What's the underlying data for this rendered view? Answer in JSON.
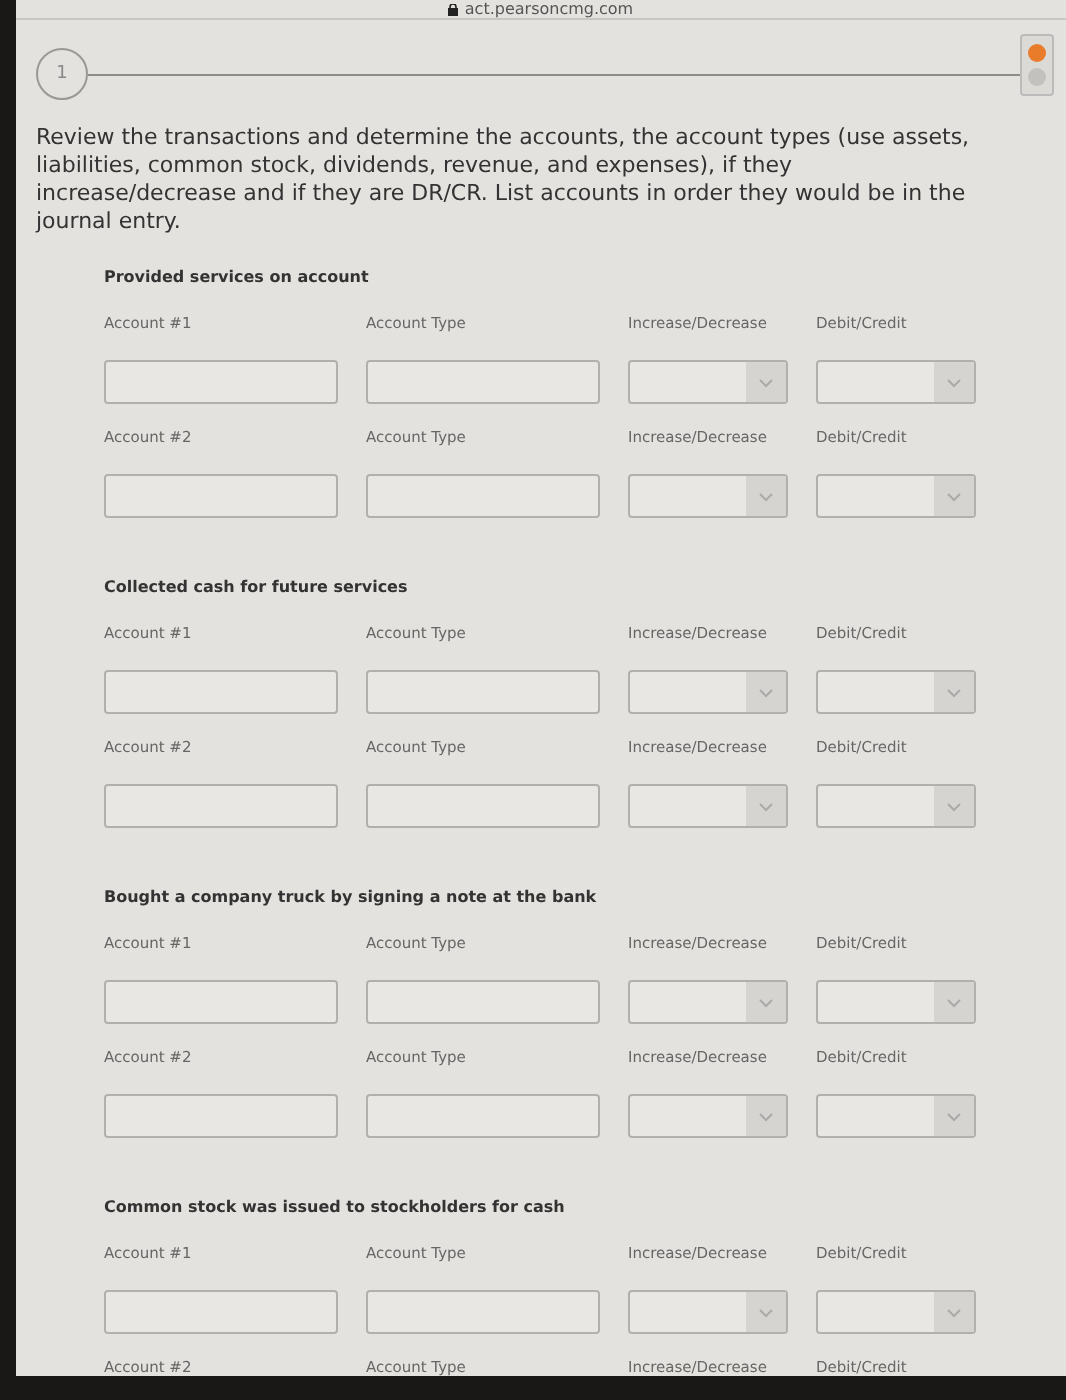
{
  "browser": {
    "url": "act.pearsoncmg.com"
  },
  "step": {
    "number": "1"
  },
  "pager": [
    {
      "selected": true
    },
    {
      "selected": false
    }
  ],
  "instructions": "Review the transactions and determine the accounts, the account types (use assets, liabilities, common stock, dividends, revenue, and expenses), if they increase/decrease and if they are DR/CR. List accounts in order they would be in the journal entry.",
  "sections": [
    {
      "title": "Provided services on account",
      "rows": [
        {
          "account": "Account #1",
          "type": "Account Type",
          "change": "Increase/Decrease",
          "side": "Debit/Credit"
        },
        {
          "account": "Account #2",
          "type": "Account Type",
          "change": "Increase/Decrease",
          "side": "Debit/Credit"
        }
      ]
    },
    {
      "title": "Collected cash for future services",
      "rows": [
        {
          "account": "Account #1",
          "type": "Account Type",
          "change": "Increase/Decrease",
          "side": "Debit/Credit"
        },
        {
          "account": "Account #2",
          "type": "Account Type",
          "change": "Increase/Decrease",
          "side": "Debit/Credit"
        }
      ]
    },
    {
      "title": "Bought a company truck by signing a note at the bank",
      "rows": [
        {
          "account": "Account #1",
          "type": "Account Type",
          "change": "Increase/Decrease",
          "side": "Debit/Credit"
        },
        {
          "account": "Account #2",
          "type": "Account Type",
          "change": "Increase/Decrease",
          "side": "Debit/Credit"
        }
      ]
    },
    {
      "title": "Common stock was issued to stockholders for cash",
      "rows": [
        {
          "account": "Account #1",
          "type": "Account Type",
          "change": "Increase/Decrease",
          "side": "Debit/Credit"
        },
        {
          "account": "Account #2",
          "type": "Account Type",
          "change": "Increase/Decrease",
          "side": "Debit/Credit"
        }
      ]
    }
  ]
}
